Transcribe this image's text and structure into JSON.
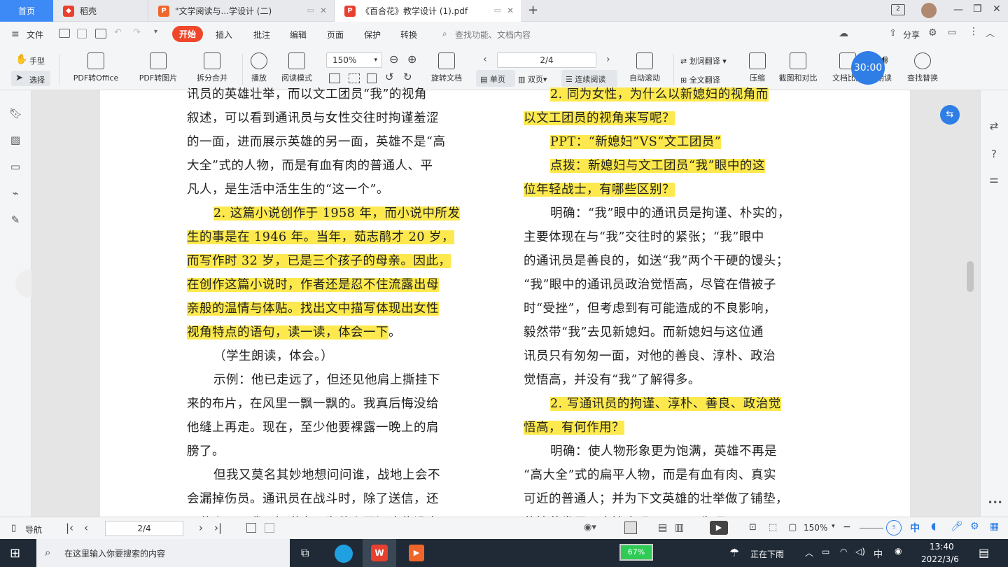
{
  "tabs": [
    {
      "label": "首页"
    },
    {
      "label": "稻壳"
    },
    {
      "label": "\"文学阅读与...学设计 (二)"
    },
    {
      "label": "《百合花》教学设计 (1).pdf"
    }
  ],
  "menu": {
    "file": "文件",
    "start": "开始",
    "insert": "插入",
    "annotate": "批注",
    "edit": "编辑",
    "page": "页面",
    "protect": "保护",
    "convert": "转换",
    "search_placeholder": "查找功能、文档内容",
    "share": "分享",
    "timer": "30:00"
  },
  "ribbon": {
    "hand": "手型",
    "select": "选择",
    "pdf_office": "PDF转Office",
    "pdf_image": "PDF转图片",
    "split_merge": "拆分合并",
    "play": "播放",
    "read_mode": "阅读模式",
    "zoom": "150%",
    "page_num": "2/4",
    "rotate": "旋转文档",
    "single": "单页",
    "double": "双页",
    "continuous": "连续阅读",
    "auto_scroll": "自动滚动",
    "word_translate": "划词翻译",
    "full_translate": "全文翻译",
    "compress": "压缩",
    "screenshot": "截图和对比",
    "compare": "文档比对",
    "read_aloud": "朗读",
    "find_replace": "查找替换"
  },
  "left_page": [
    {
      "text": "讯员的英雄壮举，而以文工团员“我”的视角",
      "hl": false
    },
    {
      "text": "叙述，可以看到通讯员与女性交往时拘谨羞涩",
      "hl": false
    },
    {
      "text": "的一面，进而展示英雄的另一面，英雄不是“高",
      "hl": false
    },
    {
      "text": "大全”式的人物，而是有血有肉的普通人、平",
      "hl": false
    },
    {
      "text": "凡人，是生活中活生生的“这一个”。",
      "hl": false
    },
    {
      "text": "2. 这篇小说创作于 1958 年，而小说中所发",
      "hl": true,
      "indent": true
    },
    {
      "text": "生的事是在 1946 年。当年，茹志鹃才 20 岁，",
      "hl": true
    },
    {
      "text": "而写作时 32 岁，已是三个孩子的母亲。因此，",
      "hl": true
    },
    {
      "text": "在创作这篇小说时，作者还是忍不住流露出母",
      "hl": true
    },
    {
      "text": "亲般的温情与体贴。找出文中描写体现出女性",
      "hl": true
    },
    {
      "text": "视角特点的语句，读一读，体会一下",
      "hl": true,
      "tail": "。"
    },
    {
      "text": "（学生朗读，体会。）",
      "hl": false,
      "indent": true
    },
    {
      "text": "示例：他已走远了，但还见他肩上撕挂下",
      "hl": false,
      "indent": true
    },
    {
      "text": "来的布片，在风里一飘一飘的。我真后悔没给",
      "hl": false
    },
    {
      "text": "他缝上再走。现在，至少他要裸露一晚上的肩",
      "hl": false
    },
    {
      "text": "膀了。",
      "hl": false
    },
    {
      "text": "但我又莫名其妙地想问问谁，战地上会不",
      "hl": false,
      "indent": true
    },
    {
      "text": "会漏掉伤员。通讯员在战斗时，除了送信，还",
      "hl": false
    },
    {
      "text": "干什么——我不知道自己为什么要问这些没意",
      "hl": false
    }
  ],
  "right_page": [
    {
      "text": "2. 同为女性，为什么以新媳妇的视角而",
      "hl": true,
      "indent": true
    },
    {
      "text": "以文工团员的视角来写呢？",
      "hl": true
    },
    {
      "text": "PPT：“新媳妇”VS“文工团员”",
      "hl": true,
      "indent": true
    },
    {
      "text": "点拨：新媳妇与文工团员“我”眼中的这",
      "hl": true,
      "indent": true
    },
    {
      "text": "位年轻战士，有哪些区别？",
      "hl": true
    },
    {
      "text": "明确：“我”眼中的通讯员是拘谨、朴实的，",
      "hl": false,
      "indent": true
    },
    {
      "text": "主要体现在与“我”交往时的紧张；“我”眼中",
      "hl": false
    },
    {
      "text": "的通讯员是善良的，如送“我”两个干硬的馒头；",
      "hl": false
    },
    {
      "text": "“我”眼中的通讯员政治觉悟高，尽管在借被子",
      "hl": false
    },
    {
      "text": "时“受挫”，但考虑到有可能造成的不良影响，",
      "hl": false
    },
    {
      "text": "毅然带“我”去见新媳妇。而新媳妇与这位通",
      "hl": false
    },
    {
      "text": "讯员只有匆匆一面，对他的善良、淳朴、政治",
      "hl": false
    },
    {
      "text": "觉悟高，并没有“我”了解得多。",
      "hl": false
    },
    {
      "text": "2. 写通讯员的拘谨、淳朴、善良、政治觉",
      "hl": true,
      "indent": true
    },
    {
      "text": "悟高，有何作用？",
      "hl": true
    },
    {
      "text": "明确：使人物形象更为饱满，英雄不再是",
      "hl": false,
      "indent": true
    },
    {
      "text": "“高大全”式的扁平人物，而是有血有肉、真实",
      "hl": false
    },
    {
      "text": "可近的普通人；并为下文英雄的壮举做了铺垫，",
      "hl": false
    },
    {
      "text": "使情节发展更合情合理，不至于生硬。",
      "hl": false
    }
  ],
  "status": {
    "nav": "导航",
    "page": "2/4",
    "zoom": "150%"
  },
  "taskbar": {
    "search": "在这里输入你要搜索的内容",
    "battery": "67%",
    "weather": "正在下雨",
    "ime": "中",
    "time": "13:40",
    "date": "2022/3/6"
  },
  "colors": {
    "highlight": "#fde94d",
    "accent": "#2f7ee6",
    "start_tab": "#f0472b",
    "taskbar": "#1f2a36"
  }
}
